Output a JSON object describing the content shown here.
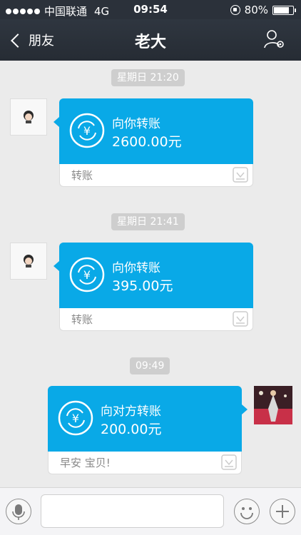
{
  "status_bar": {
    "carrier": "中国联通",
    "network": "4G",
    "time": "09:54",
    "battery": "80%",
    "battery_level": 0.8,
    "signal_bars": 5
  },
  "nav": {
    "back_label": "朋友",
    "title": "老大"
  },
  "messages": [
    {
      "timestamp": "星期日 21:20",
      "direction": "incoming",
      "title": "向你转账",
      "amount": "2600.00元",
      "footer": "转账"
    },
    {
      "timestamp": "星期日 21:41",
      "direction": "incoming",
      "title": "向你转账",
      "amount": "395.00元",
      "footer": "转账"
    },
    {
      "timestamp": "09:49",
      "direction": "outgoing",
      "title": "向对方转账",
      "amount": "200.00元",
      "footer": "早安 宝贝!"
    }
  ],
  "colors": {
    "transfer_blue": "#09a9e7",
    "nav_bg": "#2b313a",
    "chat_bg": "#ebebeb"
  },
  "icons": {
    "transfer": "yuan-transfer-icon",
    "wallet_logo": "transfer-logo-icon",
    "voice": "microphone-icon",
    "emoji": "smiley-icon",
    "more": "plus-icon",
    "profile": "profile-settings-icon"
  }
}
